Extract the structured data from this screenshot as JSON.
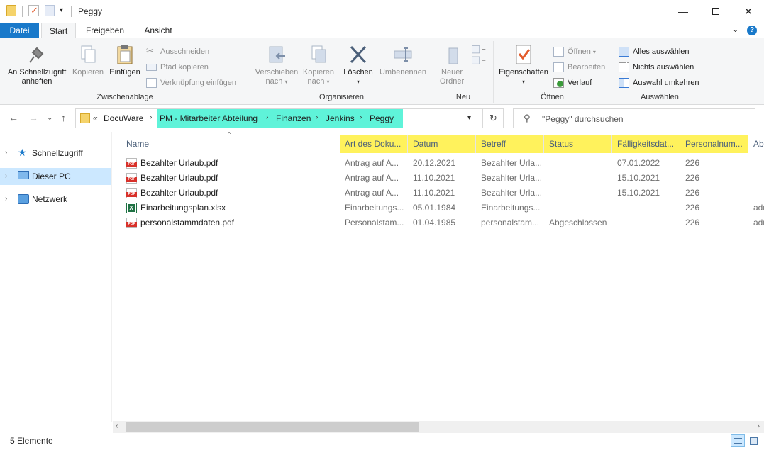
{
  "window": {
    "title": "Peggy",
    "minimize_glyph": "—",
    "close_glyph": "✕"
  },
  "ribbon_tabs": {
    "file": "Datei",
    "start": "Start",
    "share": "Freigeben",
    "view": "Ansicht",
    "help": "?"
  },
  "ribbon": {
    "clipboard": {
      "label": "Zwischenablage",
      "pin": "An Schnellzugriff anheften",
      "copy": "Kopieren",
      "paste": "Einfügen",
      "cut": "Ausschneiden",
      "copy_path": "Pfad kopieren",
      "paste_shortcut": "Verknüpfung einfügen"
    },
    "organize": {
      "label": "Organisieren",
      "move_to": "Verschieben nach",
      "copy_to": "Kopieren nach",
      "delete": "Löschen",
      "rename": "Umbenennen"
    },
    "new": {
      "label": "Neu",
      "new_folder": "Neuer Ordner"
    },
    "open": {
      "label": "Öffnen",
      "properties": "Eigenschaften",
      "open": "Öffnen",
      "edit": "Bearbeiten",
      "history": "Verlauf"
    },
    "select": {
      "label": "Auswählen",
      "select_all": "Alles auswählen",
      "select_none": "Nichts auswählen",
      "invert": "Auswahl umkehren"
    }
  },
  "address": {
    "overflow": "«",
    "crumbs": [
      "DocuWare",
      "PM - Mitarbeiter Abteilung",
      "Finanzen",
      "Jenkins",
      "Peggy"
    ],
    "separator": "›",
    "search_placeholder": "\"Peggy\" durchsuchen"
  },
  "nav": {
    "items": [
      {
        "label": "Schnellzugriff",
        "icon": "star-icon"
      },
      {
        "label": "Dieser PC",
        "icon": "computer-icon",
        "selected": true
      },
      {
        "label": "Netzwerk",
        "icon": "network-icon"
      }
    ]
  },
  "columns": [
    {
      "label": "Name",
      "highlighted": false
    },
    {
      "label": "Art des Doku...",
      "highlighted": true
    },
    {
      "label": "Datum",
      "highlighted": true
    },
    {
      "label": "Betreff",
      "highlighted": true
    },
    {
      "label": "Status",
      "highlighted": true
    },
    {
      "label": "Fälligkeitsdat...",
      "highlighted": true
    },
    {
      "label": "Personalnum...",
      "highlighted": true
    },
    {
      "label": "Ab",
      "highlighted": false
    }
  ],
  "files": [
    {
      "name": "Bezahlter Urlaub.pdf",
      "type": "pdf",
      "art": "Antrag auf A...",
      "datum": "20.12.2021",
      "betreff": "Bezahlter Urla...",
      "status": "",
      "faellig": "07.01.2022",
      "personal": "226",
      "ab": ""
    },
    {
      "name": "Bezahlter Urlaub.pdf",
      "type": "pdf",
      "art": "Antrag auf A...",
      "datum": "11.10.2021",
      "betreff": "Bezahlter Urla...",
      "status": "",
      "faellig": "15.10.2021",
      "personal": "226",
      "ab": ""
    },
    {
      "name": "Bezahlter Urlaub.pdf",
      "type": "pdf",
      "art": "Antrag auf A...",
      "datum": "11.10.2021",
      "betreff": "Bezahlter Urla...",
      "status": "",
      "faellig": "15.10.2021",
      "personal": "226",
      "ab": ""
    },
    {
      "name": "Einarbeitungsplan.xlsx",
      "type": "xlsx",
      "art": "Einarbeitungs...",
      "datum": "05.01.1984",
      "betreff": "Einarbeitungs...",
      "status": "",
      "faellig": "",
      "personal": "226",
      "ab": "adr"
    },
    {
      "name": "personalstammdaten.pdf",
      "type": "pdf",
      "art": "Personalstam...",
      "datum": "01.04.1985",
      "betreff": "personalstam...",
      "status": "Abgeschlossen",
      "faellig": "",
      "personal": "226",
      "ab": "adr"
    }
  ],
  "statusbar": {
    "count": "5 Elemente"
  },
  "colors": {
    "accent": "#1979ca",
    "address_highlight": "#5ff3d9",
    "column_highlight": "#fff25c",
    "selection": "#cce8ff"
  }
}
